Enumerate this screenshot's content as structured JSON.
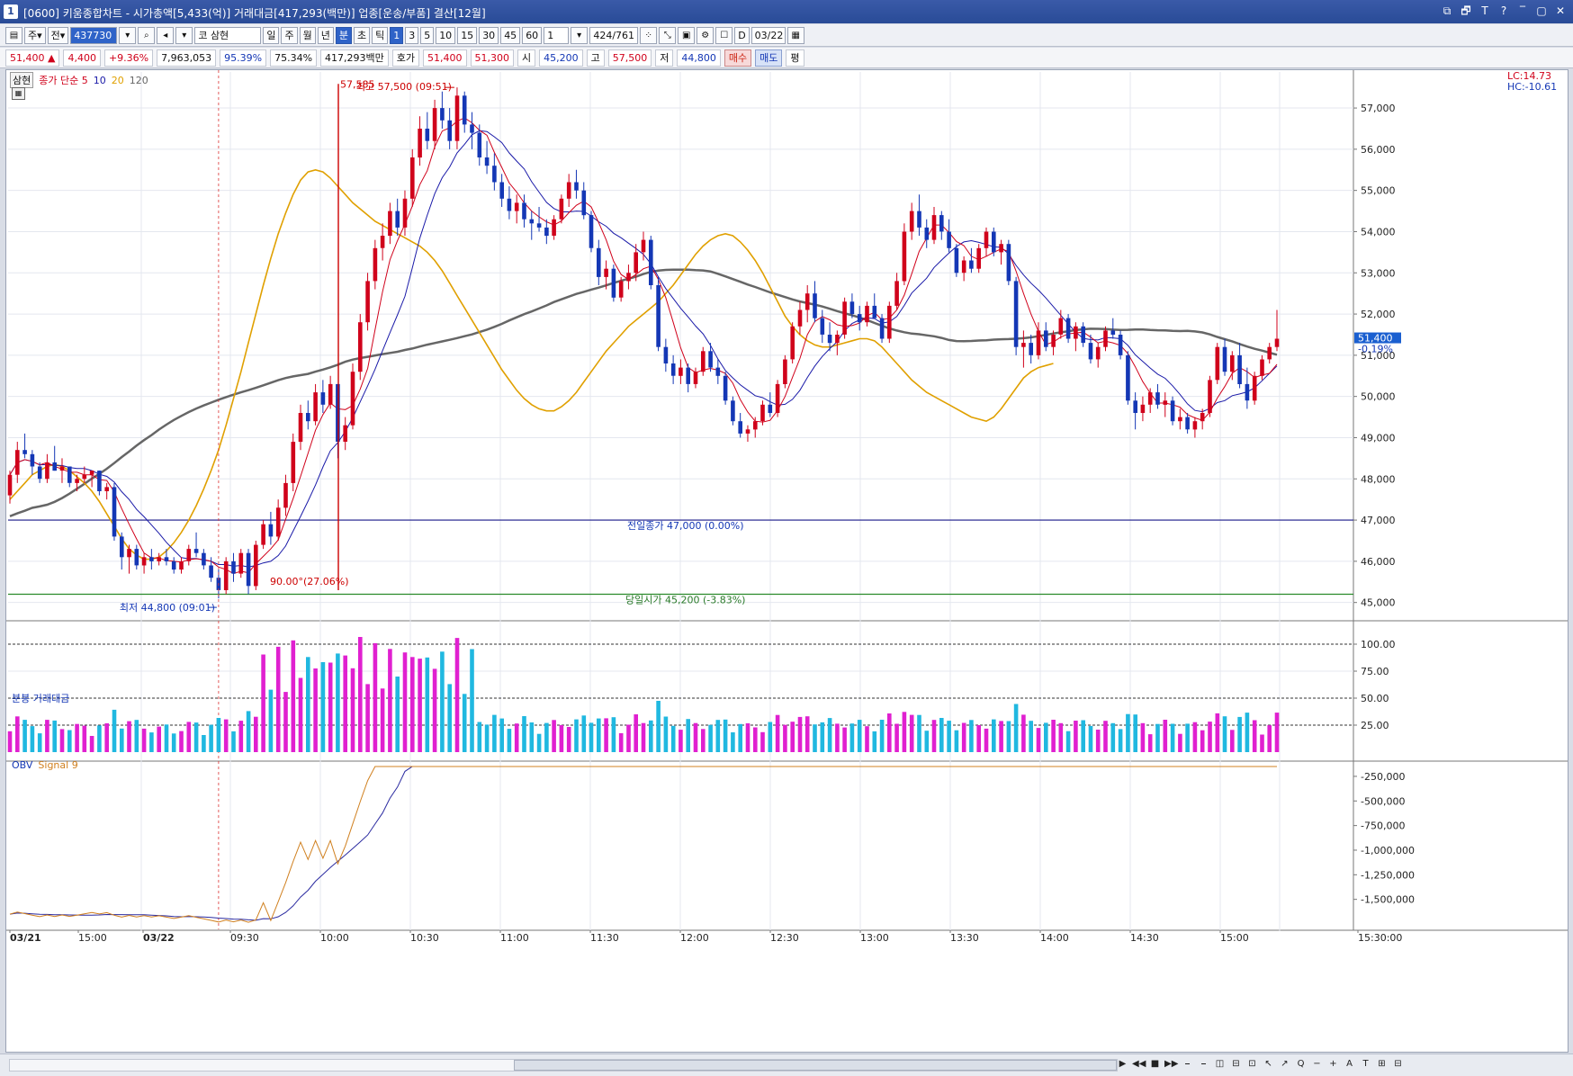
{
  "window": {
    "icon_label": "1",
    "title": "[0600] 키움종합차트 - 시가총액[5,433(억)] 거래대금[417,293(백만)] 업종[운송/부품] 결산[12월]",
    "buttons": [
      "⧉",
      "🗗",
      "T",
      "?",
      "‾",
      "▢",
      "✕"
    ]
  },
  "toolbar": {
    "market_type": "주",
    "period_select": "전",
    "stock_code": "437730",
    "search_icon": "search-icon",
    "sound_icon": "sound-icon",
    "stock_name_prefix": "코",
    "stock_name": "삼현",
    "period_buttons": [
      "일",
      "주",
      "월",
      "년",
      "분",
      "초",
      "틱"
    ],
    "selected_period": "분",
    "interval_buttons": [
      "1",
      "3",
      "5",
      "10",
      "15",
      "30",
      "45",
      "60"
    ],
    "selected_interval": "1",
    "interval_value": "1",
    "count_display": "424/761",
    "date_value": "03/22",
    "date_checkbox_label": "D"
  },
  "quote": {
    "price": "51,400",
    "change_arrow": "▲",
    "change": "4,400",
    "change_pct": "+9.36%",
    "volume": "7,963,053",
    "pct1": "95.39%",
    "pct2": "75.34%",
    "amount": "417,293백만",
    "ask_label": "호가",
    "ask1": "51,400",
    "ask2": "51,300",
    "open_label": "시",
    "open": "45,200",
    "high_label": "고",
    "high": "57,500",
    "low_label": "저",
    "low": "44,800",
    "buy_label": "매수",
    "sell_label": "매도",
    "eval_label": "평"
  },
  "price_panel": {
    "stock_tag": "삼현",
    "ma_legend": [
      {
        "label": "종가 단순 5",
        "color": "#d0021b"
      },
      {
        "label": "10",
        "color": "#1a1aa8"
      },
      {
        "label": "20",
        "color": "#e0a000"
      },
      {
        "label": "120",
        "color": "#666666"
      }
    ],
    "lc_label": "LC:14.73",
    "hc_label": "HC:-10.61",
    "current_price_tag": "51,400",
    "current_pct_tag": "-0.19%",
    "high_annotation": "최고 57,500 (09:51)",
    "low_annotation": "최저 44,800 (09:01)",
    "measure_top_label": "57,585",
    "measure_bottom_label": "90.00°(27.06%)",
    "prev_close_label": "전일종가 47,000 (0.00%)",
    "open_label": "당일시가 45,200 (-3.83%)",
    "y_ticks": [
      "57,000",
      "56,000",
      "55,000",
      "54,000",
      "53,000",
      "52,000",
      "51,000",
      "50,000",
      "49,000",
      "48,000",
      "47,000",
      "46,000",
      "45,000"
    ]
  },
  "volume_panel": {
    "title": "분봉 거래대금",
    "y_ticks": [
      "100.00",
      "75.00",
      "50.00",
      "25.00"
    ]
  },
  "obv_panel": {
    "title": "OBV",
    "signal_label": "Signal 9",
    "y_ticks": [
      "-250,000",
      "-500,000",
      "-750,000",
      "-1,000,000",
      "-1,250,000",
      "-1,500,000"
    ]
  },
  "x_axis": {
    "ticks": [
      "03/21",
      "15:00",
      "03/22",
      "09:30",
      "10:00",
      "10:30",
      "11:00",
      "11:30",
      "12:00",
      "12:30",
      "13:00",
      "13:30",
      "14:00",
      "14:30",
      "15:00",
      "15:30:00"
    ]
  },
  "bottom_nav": [
    "▶",
    "◀◀",
    "■",
    "▶▶",
    "⎯",
    "⎯",
    "◫",
    "⊟",
    "⊡",
    "↖",
    "↗",
    "Q",
    "−",
    "+",
    "A",
    "T",
    "⊞",
    "⊟"
  ],
  "colors": {
    "up": "#d0021b",
    "down": "#1437b5",
    "ma5": "#d0021b",
    "ma10": "#1a1aa8",
    "ma20": "#e0a000",
    "ma120": "#666666",
    "vol_up": "#e020d0",
    "vol_down": "#20b8e0",
    "obv": "#2a2aa0",
    "signal": "#d08020"
  },
  "chart_data": {
    "type": "candlestick",
    "unit": "KRW",
    "ylim": [
      44600,
      57700
    ],
    "candles_ohlc": [
      [
        47600,
        48200,
        47400,
        48100
      ],
      [
        48100,
        48900,
        47900,
        48700
      ],
      [
        48700,
        49100,
        48500,
        48600
      ],
      [
        48600,
        48700,
        48100,
        48300
      ],
      [
        48300,
        48400,
        47900,
        48000
      ],
      [
        48000,
        48600,
        47900,
        48400
      ],
      [
        48400,
        48800,
        48200,
        48200
      ],
      [
        48200,
        48500,
        47900,
        48300
      ],
      [
        48300,
        48300,
        47800,
        47900
      ],
      [
        47900,
        48100,
        47700,
        48000
      ],
      [
        48000,
        48300,
        47900,
        48100
      ],
      [
        48100,
        48200,
        47800,
        48200
      ],
      [
        48200,
        48200,
        47600,
        47700
      ],
      [
        47700,
        47900,
        47500,
        47800
      ],
      [
        47800,
        47900,
        46500,
        46600
      ],
      [
        46600,
        46700,
        45800,
        46100
      ],
      [
        46100,
        46400,
        45700,
        46300
      ],
      [
        46300,
        46400,
        45800,
        45900
      ],
      [
        45900,
        46200,
        45700,
        46100
      ],
      [
        46100,
        46300,
        45800,
        46000
      ],
      [
        46000,
        46200,
        45900,
        46100
      ],
      [
        46100,
        46300,
        45900,
        46000
      ],
      [
        46000,
        46100,
        45700,
        45800
      ],
      [
        45800,
        46100,
        45700,
        46000
      ],
      [
        46000,
        46400,
        45900,
        46300
      ],
      [
        46300,
        46700,
        46100,
        46200
      ],
      [
        46200,
        46300,
        45800,
        45900
      ],
      [
        45900,
        46100,
        45500,
        45600
      ],
      [
        45600,
        45800,
        45100,
        45300
      ],
      [
        45300,
        46100,
        45200,
        46000
      ],
      [
        46000,
        46200,
        45500,
        45700
      ],
      [
        45700,
        46300,
        45600,
        46200
      ],
      [
        46200,
        46300,
        45200,
        45400
      ],
      [
        45400,
        46500,
        45300,
        46400
      ],
      [
        46400,
        47000,
        46300,
        46900
      ],
      [
        46900,
        47200,
        46400,
        46600
      ],
      [
        46600,
        47500,
        46500,
        47300
      ],
      [
        47300,
        48100,
        47100,
        47900
      ],
      [
        47900,
        49100,
        47700,
        48900
      ],
      [
        48900,
        49800,
        48700,
        49600
      ],
      [
        49600,
        49900,
        49200,
        49400
      ],
      [
        49400,
        50300,
        49300,
        50100
      ],
      [
        50100,
        50400,
        49600,
        49800
      ],
      [
        49800,
        50500,
        49700,
        50300
      ],
      [
        50300,
        50300,
        48500,
        48900
      ],
      [
        48900,
        49500,
        48700,
        49300
      ],
      [
        49300,
        50800,
        49200,
        50600
      ],
      [
        50600,
        52000,
        50400,
        51800
      ],
      [
        51800,
        53000,
        51600,
        52800
      ],
      [
        52800,
        53800,
        52600,
        53600
      ],
      [
        53600,
        54200,
        53300,
        53900
      ],
      [
        53900,
        54700,
        53700,
        54500
      ],
      [
        54500,
        54800,
        53900,
        54100
      ],
      [
        54100,
        55000,
        53900,
        54800
      ],
      [
        54800,
        56000,
        54600,
        55800
      ],
      [
        55800,
        56800,
        55600,
        56500
      ],
      [
        56500,
        56900,
        56000,
        56200
      ],
      [
        56200,
        57200,
        56000,
        57000
      ],
      [
        57000,
        57400,
        56500,
        56700
      ],
      [
        56700,
        57000,
        56000,
        56200
      ],
      [
        56200,
        57500,
        56000,
        57300
      ],
      [
        57300,
        57400,
        56400,
        56600
      ],
      [
        56600,
        56900,
        56000,
        56400
      ],
      [
        56400,
        56600,
        55600,
        55800
      ],
      [
        55800,
        56200,
        55400,
        55600
      ],
      [
        55600,
        55900,
        55000,
        55200
      ],
      [
        55200,
        55400,
        54600,
        54800
      ],
      [
        54800,
        55100,
        54300,
        54500
      ],
      [
        54500,
        54900,
        54200,
        54700
      ],
      [
        54700,
        54900,
        54100,
        54300
      ],
      [
        54300,
        54500,
        53800,
        54200
      ],
      [
        54200,
        54600,
        54000,
        54100
      ],
      [
        54100,
        54300,
        53700,
        53900
      ],
      [
        53900,
        54400,
        53800,
        54300
      ],
      [
        54300,
        54900,
        54200,
        54800
      ],
      [
        54800,
        55400,
        54600,
        55200
      ],
      [
        55200,
        55500,
        54800,
        55000
      ],
      [
        55000,
        55200,
        54300,
        54400
      ],
      [
        54400,
        54500,
        53500,
        53600
      ],
      [
        53600,
        53800,
        52700,
        52900
      ],
      [
        52900,
        53300,
        52600,
        53100
      ],
      [
        53100,
        53200,
        52300,
        52400
      ],
      [
        52400,
        52900,
        52300,
        52800
      ],
      [
        52800,
        53200,
        52600,
        53000
      ],
      [
        53000,
        53700,
        52800,
        53500
      ],
      [
        53500,
        54000,
        53300,
        53800
      ],
      [
        53800,
        53900,
        52600,
        52700
      ],
      [
        52700,
        52900,
        51100,
        51200
      ],
      [
        51200,
        51400,
        50600,
        50800
      ],
      [
        50800,
        51000,
        50300,
        50500
      ],
      [
        50500,
        50900,
        50300,
        50700
      ],
      [
        50700,
        50800,
        50100,
        50300
      ],
      [
        50300,
        50700,
        50200,
        50600
      ],
      [
        50600,
        51200,
        50500,
        51100
      ],
      [
        51100,
        51300,
        50600,
        50700
      ],
      [
        50700,
        50900,
        50300,
        50500
      ],
      [
        50500,
        50600,
        49800,
        49900
      ],
      [
        49900,
        50000,
        49300,
        49400
      ],
      [
        49400,
        49600,
        49000,
        49100
      ],
      [
        49100,
        49300,
        48900,
        49200
      ],
      [
        49200,
        49500,
        49000,
        49400
      ],
      [
        49400,
        49900,
        49300,
        49800
      ],
      [
        49800,
        50100,
        49500,
        49600
      ],
      [
        49600,
        50400,
        49500,
        50300
      ],
      [
        50300,
        51000,
        50200,
        50900
      ],
      [
        50900,
        51800,
        50800,
        51700
      ],
      [
        51700,
        52300,
        51500,
        52100
      ],
      [
        52100,
        52700,
        51800,
        52500
      ],
      [
        52500,
        52800,
        51800,
        51900
      ],
      [
        51900,
        52100,
        51300,
        51500
      ],
      [
        51500,
        51800,
        51100,
        51300
      ],
      [
        51300,
        51600,
        51000,
        51500
      ],
      [
        51500,
        52400,
        51400,
        52300
      ],
      [
        52300,
        52500,
        51900,
        52000
      ],
      [
        52000,
        52200,
        51600,
        51800
      ],
      [
        51800,
        52300,
        51700,
        52200
      ],
      [
        52200,
        52500,
        51900,
        51900
      ],
      [
        51900,
        52000,
        51300,
        51400
      ],
      [
        51400,
        52300,
        51300,
        52200
      ],
      [
        52200,
        53000,
        52100,
        52800
      ],
      [
        52800,
        54200,
        52700,
        54000
      ],
      [
        54000,
        54700,
        53800,
        54500
      ],
      [
        54500,
        54900,
        53900,
        54100
      ],
      [
        54100,
        54300,
        53600,
        53800
      ],
      [
        53800,
        54600,
        53700,
        54400
      ],
      [
        54400,
        54500,
        53800,
        54000
      ],
      [
        54000,
        54300,
        53500,
        53600
      ],
      [
        53600,
        53700,
        52900,
        53000
      ],
      [
        53000,
        53400,
        52800,
        53300
      ],
      [
        53300,
        53600,
        53000,
        53100
      ],
      [
        53100,
        53700,
        53000,
        53600
      ],
      [
        53600,
        54100,
        53400,
        54000
      ],
      [
        54000,
        54100,
        53400,
        53500
      ],
      [
        53500,
        53800,
        53200,
        53700
      ],
      [
        53700,
        53800,
        52700,
        52800
      ],
      [
        52800,
        52900,
        51000,
        51200
      ],
      [
        51200,
        51600,
        50700,
        51300
      ],
      [
        51300,
        51500,
        50800,
        51000
      ],
      [
        51000,
        51800,
        50900,
        51600
      ],
      [
        51600,
        51800,
        51100,
        51200
      ],
      [
        51200,
        51600,
        51000,
        51500
      ],
      [
        51500,
        52100,
        51400,
        51900
      ],
      [
        51900,
        52000,
        51300,
        51400
      ],
      [
        51400,
        51800,
        51100,
        51700
      ],
      [
        51700,
        51800,
        51200,
        51300
      ],
      [
        51300,
        51500,
        50800,
        50900
      ],
      [
        50900,
        51300,
        50700,
        51200
      ],
      [
        51200,
        51700,
        51100,
        51600
      ],
      [
        51600,
        51900,
        51400,
        51500
      ],
      [
        51500,
        51600,
        50900,
        51000
      ],
      [
        51000,
        51100,
        49800,
        49900
      ],
      [
        49900,
        50100,
        49200,
        49600
      ],
      [
        49600,
        50000,
        49400,
        49800
      ],
      [
        49800,
        50200,
        49600,
        50100
      ],
      [
        50100,
        50300,
        49700,
        49800
      ],
      [
        49800,
        50100,
        49500,
        49900
      ],
      [
        49900,
        50000,
        49300,
        49400
      ],
      [
        49400,
        49700,
        49200,
        49500
      ],
      [
        49500,
        49600,
        49100,
        49200
      ],
      [
        49200,
        49500,
        49000,
        49400
      ],
      [
        49400,
        49700,
        49200,
        49600
      ],
      [
        49600,
        50500,
        49500,
        50400
      ],
      [
        50400,
        51300,
        50300,
        51200
      ],
      [
        51200,
        51400,
        50500,
        50600
      ],
      [
        50600,
        51100,
        50400,
        51000
      ],
      [
        51000,
        51300,
        50200,
        50300
      ],
      [
        50300,
        50700,
        49700,
        49900
      ],
      [
        49900,
        50600,
        49800,
        50500
      ],
      [
        50500,
        51000,
        50400,
        50900
      ],
      [
        50900,
        51300,
        50800,
        51200
      ],
      [
        51200,
        52100,
        51100,
        51400
      ]
    ],
    "ma20_series": [
      47500,
      47700,
      47900,
      48100,
      48200,
      48300,
      48350,
      48300,
      48200,
      48050,
      47900,
      47700,
      47450,
      47150,
      46850,
      46550,
      46300,
      46150,
      46050,
      46050,
      46100,
      46250,
      46450,
      46700,
      47000,
      47350,
      47750,
      48200,
      48700,
      49300,
      49950,
      50600,
      51300,
      52000,
      52700,
      53350,
      53950,
      54450,
      54900,
      55250,
      55450,
      55500,
      55450,
      55300,
      55100,
      54900,
      54700,
      54550,
      54400,
      54250,
      54150,
      54050,
      53950,
      53850,
      53750,
      53650,
      53500,
      53300,
      53050,
      52750,
      52450,
      52150,
      51850,
      51550,
      51250,
      50950,
      50650,
      50400,
      50150,
      49950,
      49800,
      49700,
      49650,
      49650,
      49750,
      49900,
      50100,
      50350,
      50600,
      50850,
      51100,
      51300,
      51500,
      51700,
      51850,
      52000,
      52150,
      52300,
      52500,
      52700,
      52950,
      53200,
      53450,
      53650,
      53800,
      53900,
      53950,
      53900,
      53750,
      53550,
      53300,
      53000,
      52650,
      52300,
      51950,
      51700,
      51500,
      51350,
      51250,
      51200,
      51200,
      51250,
      51300,
      51350,
      51400,
      51400,
      51350,
      51200,
      51000,
      50800,
      50600,
      50400,
      50250,
      50100,
      50000,
      49900,
      49800,
      49700,
      49600,
      49500,
      49450,
      49400,
      49500,
      49700,
      49950,
      50200,
      50450,
      50600,
      50700,
      50750,
      50800
    ]
  }
}
